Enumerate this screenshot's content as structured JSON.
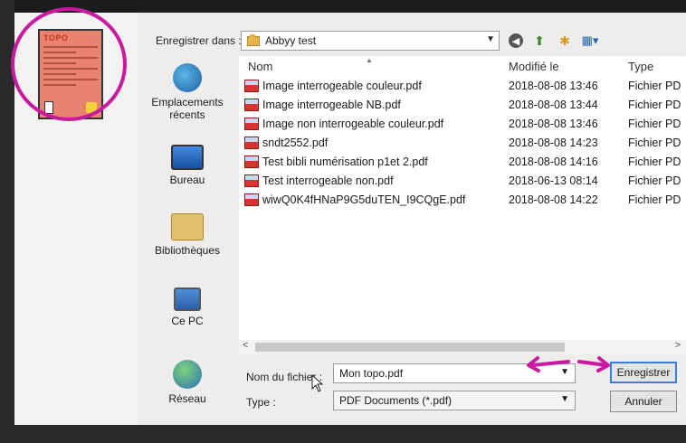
{
  "dialog": {
    "save_in_label": "Enregistrer dans :",
    "current_folder": "Abbyy test",
    "places": [
      {
        "label_lines": [
          "Emplacements",
          "récents"
        ],
        "icon": "recent-places-icon"
      },
      {
        "label_lines": [
          "Bureau"
        ],
        "icon": "desktop-icon"
      },
      {
        "label_lines": [
          "Bibliothèques"
        ],
        "icon": "libraries-icon"
      },
      {
        "label_lines": [
          "Ce PC"
        ],
        "icon": "this-pc-icon"
      },
      {
        "label_lines": [
          "Réseau"
        ],
        "icon": "network-icon"
      }
    ],
    "columns": {
      "name": "Nom",
      "modified": "Modifié le",
      "type": "Type"
    },
    "files": [
      {
        "name": "Image interrogeable couleur.pdf",
        "modified": "2018-08-08 13:46",
        "type": "Fichier PD"
      },
      {
        "name": "Image interrogeable NB.pdf",
        "modified": "2018-08-08 13:44",
        "type": "Fichier PD"
      },
      {
        "name": "Image non interrogeable couleur.pdf",
        "modified": "2018-08-08 13:46",
        "type": "Fichier PD"
      },
      {
        "name": "sndt2552.pdf",
        "modified": "2018-08-08 14:23",
        "type": "Fichier PD"
      },
      {
        "name": "Test bibli numérisation p1et 2.pdf",
        "modified": "2018-08-08 14:16",
        "type": "Fichier PD"
      },
      {
        "name": "Test interrogeable non.pdf",
        "modified": "2018-06-13 08:14",
        "type": "Fichier PD"
      },
      {
        "name": "wiwQ0K4fHNaP9G5duTEN_I9CQgE.pdf",
        "modified": "2018-08-08 14:22",
        "type": "Fichier PD"
      }
    ],
    "filename_label": "Nom du fichier :",
    "filename_value": "Mon topo.pdf",
    "type_label": "Type :",
    "type_value": "PDF Documents (*.pdf)",
    "save_button": "Enregistrer",
    "cancel_button": "Annuler"
  },
  "thumbnail": {
    "title": "TOPO"
  },
  "annotation_color": "#c919a0"
}
